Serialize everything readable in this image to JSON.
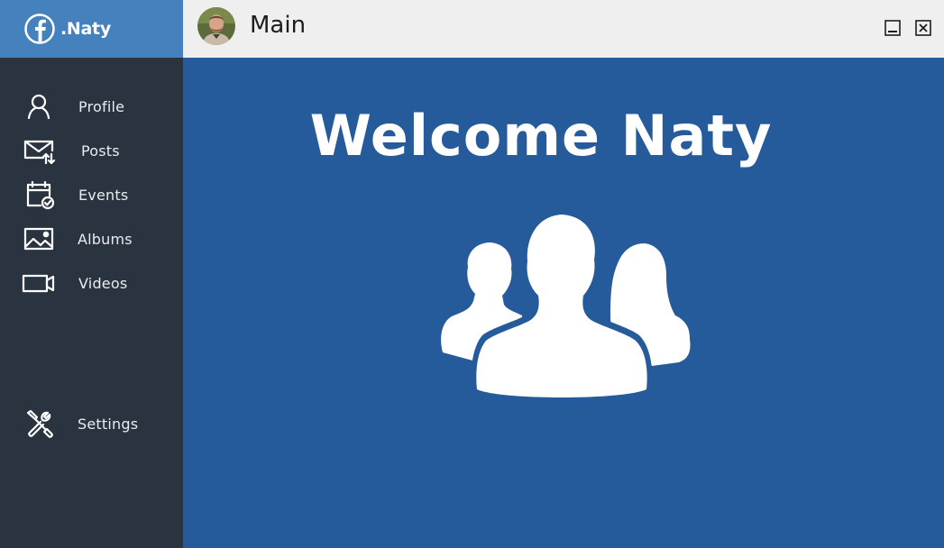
{
  "brand": {
    "name": ".Naty",
    "logo_icon": "facebook-icon"
  },
  "sidebar": {
    "items": [
      {
        "label": "Profile",
        "icon": "user-icon"
      },
      {
        "label": "Posts",
        "icon": "mail-icon"
      },
      {
        "label": "Events",
        "icon": "calendar-icon"
      },
      {
        "label": "Albums",
        "icon": "image-icon"
      },
      {
        "label": "Videos",
        "icon": "video-icon"
      }
    ],
    "settings": {
      "label": "Settings",
      "icon": "tools-icon"
    }
  },
  "titlebar": {
    "title": "Main",
    "avatar_icon": "avatar",
    "minimize_icon": "minimize-icon",
    "close_icon": "close-icon"
  },
  "main": {
    "welcome": "Welcome Naty",
    "illustration_icon": "group-users-icon"
  },
  "colors": {
    "sidebar_bg": "#2a3440",
    "brand_bg": "#4582bd",
    "main_bg": "#255a9b",
    "titlebar_bg": "#efefef",
    "text_light": "#e8ecef"
  }
}
